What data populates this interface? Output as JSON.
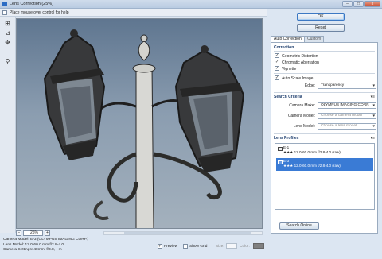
{
  "window": {
    "title": "Lens Correction (25%)",
    "minimize": "–",
    "maximize": "□",
    "close": "x"
  },
  "help": {
    "text": "Place mouse over control for help"
  },
  "tools": [
    {
      "name": "remove-distortion-tool-icon",
      "glyph": "⊞"
    },
    {
      "name": "straighten-tool-icon",
      "glyph": "⊿"
    },
    {
      "name": "move-grid-tool-icon",
      "glyph": "✥"
    },
    {
      "name": "hand-tool-icon",
      "glyph": "✋"
    },
    {
      "name": "zoom-tool-icon",
      "glyph": "⚲"
    }
  ],
  "zoom": {
    "value": "25%",
    "minus": "–",
    "plus": "+"
  },
  "info": {
    "camera_model": "Camera Model: E-3 (OLYMPUS IMAGING CORP.)",
    "lens_model": "Lens Model: 12.0-60.0 mm f/2.8-4.0",
    "camera_settings": "Camera Settings: 40mm, f/3.8, --m"
  },
  "preview": {
    "preview_label": "Preview",
    "preview_checked": true,
    "grid_label": "Show Grid",
    "grid_checked": false,
    "size_label": "Size:",
    "size_value": "",
    "color_label": "Color:",
    "color_value": "#808080"
  },
  "buttons": {
    "ok": "OK",
    "reset": "Reset"
  },
  "tabs": [
    {
      "label": "Auto Correction",
      "active": true
    },
    {
      "label": "Custom",
      "active": false
    }
  ],
  "correction": {
    "heading": "Correction",
    "items": [
      {
        "label": "Geometric Distortion",
        "checked": true
      },
      {
        "label": "Chromatic Aberration",
        "checked": true
      },
      {
        "label": "Vignette",
        "checked": true
      }
    ],
    "auto_scale": {
      "label": "Auto Scale Image",
      "checked": true
    },
    "edge_label": "Edge:",
    "edge_value": "Transparency"
  },
  "search_criteria": {
    "heading": "Search Criteria",
    "camera_make_label": "Camera Make:",
    "camera_make_value": "OLYMPUS IMAGING CORP.",
    "camera_model_label": "Camera Model:",
    "camera_model_placeholder": "Choose a camera model",
    "lens_model_label": "Lens Model:",
    "lens_model_placeholder": "Choose a lens model",
    "menu_glyph": "▾≡"
  },
  "lens_profiles": {
    "heading": "Lens Profiles",
    "menu_glyph": "▾≡",
    "items": [
      {
        "camera": "E-1",
        "lens": "★★★ 12.0-60.0 mm f/2.8-4.0 (raw)",
        "selected": false
      },
      {
        "camera": "E-3",
        "lens": "★★★ 12.0-60.0 mm f/2.8-4.0 (raw)",
        "selected": true
      }
    ],
    "search_online": "Search Online"
  },
  "checkmark": "✓",
  "arrow": "▾"
}
